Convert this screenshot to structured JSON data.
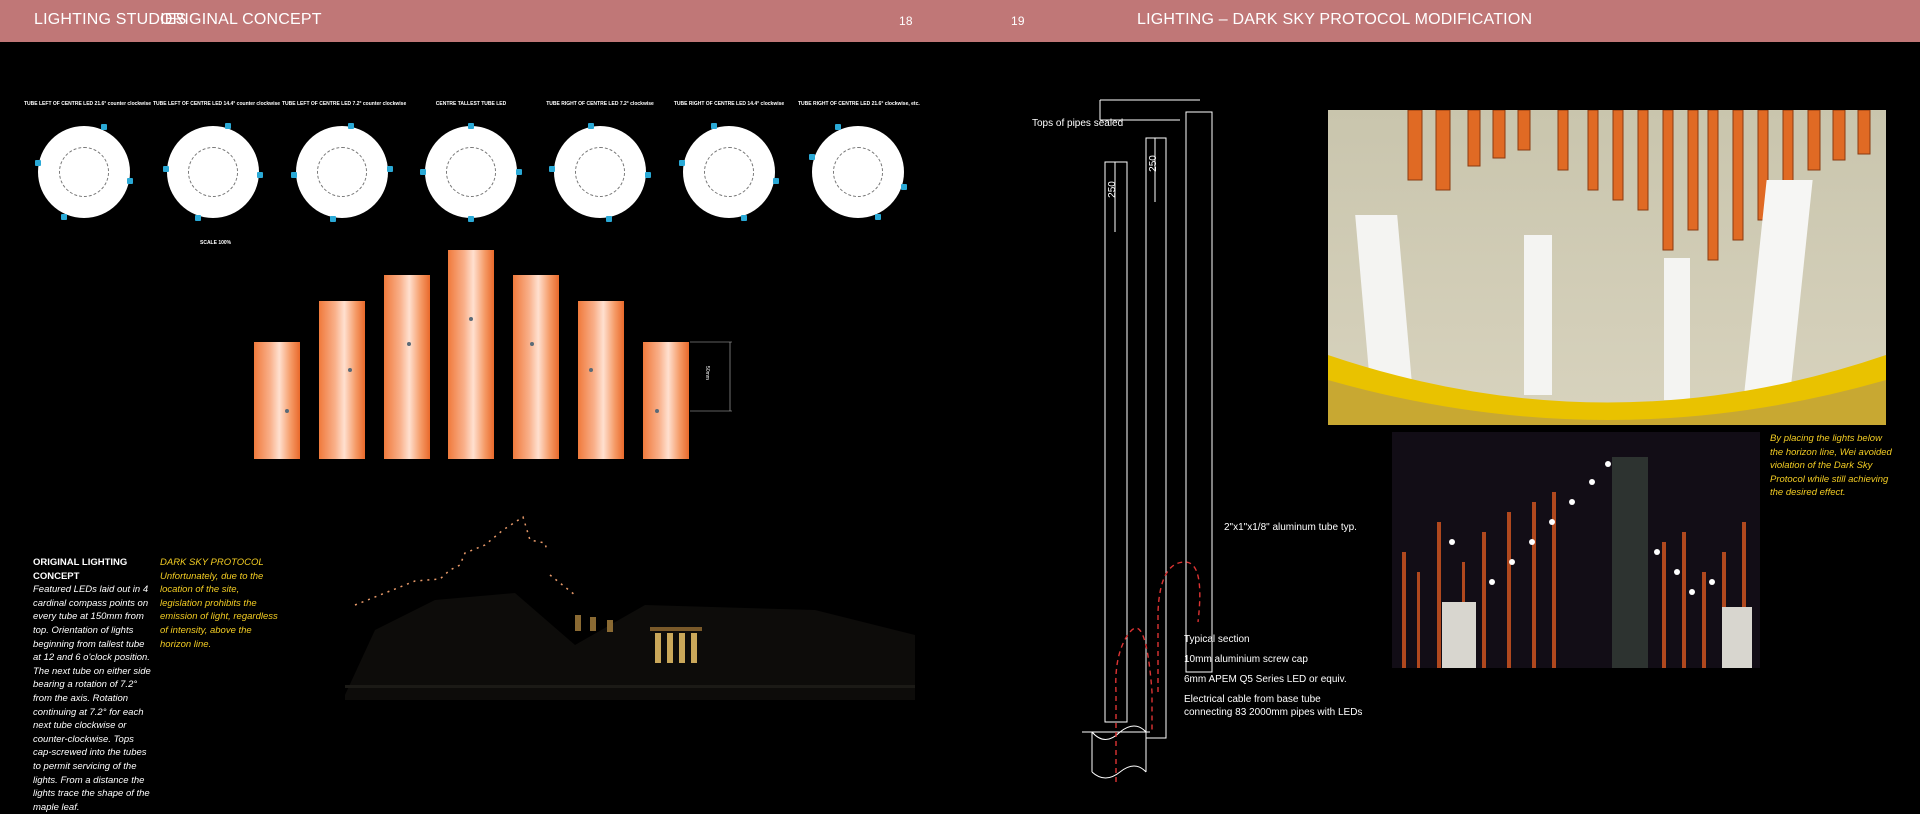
{
  "header": {
    "left_title": "LIGHTING STUDIES",
    "left_subtitle": "ORIGINAL CONCEPT",
    "page_left": "18",
    "page_right": "19",
    "right_title": "LIGHTING – DARK SKY PROTOCOL MODIFICATION"
  },
  "left_page": {
    "rotation_labels": [
      "TUBE LEFT OF CENTRE LED 21.6° counter clockwise",
      "TUBE LEFT OF CENTRE LED 14.4° counter clockwise",
      "TUBE LEFT OF CENTRE LED 7.2° counter clockwise",
      "CENTRE TALLEST TUBE LED",
      "TUBE RIGHT OF CENTRE LED 7.2° clockwise",
      "TUBE RIGHT OF CENTRE LED 14.4° clockwise",
      "TUBE RIGHT OF CENTRE LED 21.6° clockwise, etc."
    ],
    "scale_label": "SCALE 100%",
    "dimension_label": "50mm",
    "original_concept": {
      "heading": "ORIGINAL LIGHTING CONCEPT",
      "body": "Featured LEDs laid out in 4 cardinal compass points on every tube at 150mm from top. Orientation of lights beginning from tallest tube at 12 and 6 o'clock position. The next tube on either side bearing a rotation of 7.2° from the axis. Rotation continuing at 7.2° for each next tube clockwise or counter-clockwise. Tops cap-screwed into the tubes to permit servicing of the lights. From a distance the lights trace the shape of the maple leaf."
    },
    "dark_sky": {
      "heading": "DARK SKY PROTOCOL",
      "body": "Unfortunately, due to the location of the site, legislation prohibits the emission of light, regardless of intensity, above the horizon line."
    }
  },
  "right_page": {
    "drawing_notes": {
      "tops_sealed": "Tops of pipes sealed",
      "dim_250_a": "250",
      "dim_250_b": "250",
      "aluminum_tube": "2\"x1\"x1/8\" aluminum tube typ.",
      "typical_section": "Typical section",
      "screw_cap": "10mm aluminium screw cap",
      "led": "6mm APEM Q5 Series LED or equiv.",
      "cable_line1": "Electrical cable from base tube",
      "cable_line2": "connecting 83 2000mm pipes with LEDs"
    },
    "caption": "By placing the lights below the horizon line, Wei avoided violation of the Dark Sky Protocol while still achieving the desired effect."
  },
  "colors": {
    "header_band": "#c07777",
    "led_blue": "#2aa9d6",
    "tube_orange": "#f07a3c",
    "caption_yellow": "#f2cc23"
  }
}
